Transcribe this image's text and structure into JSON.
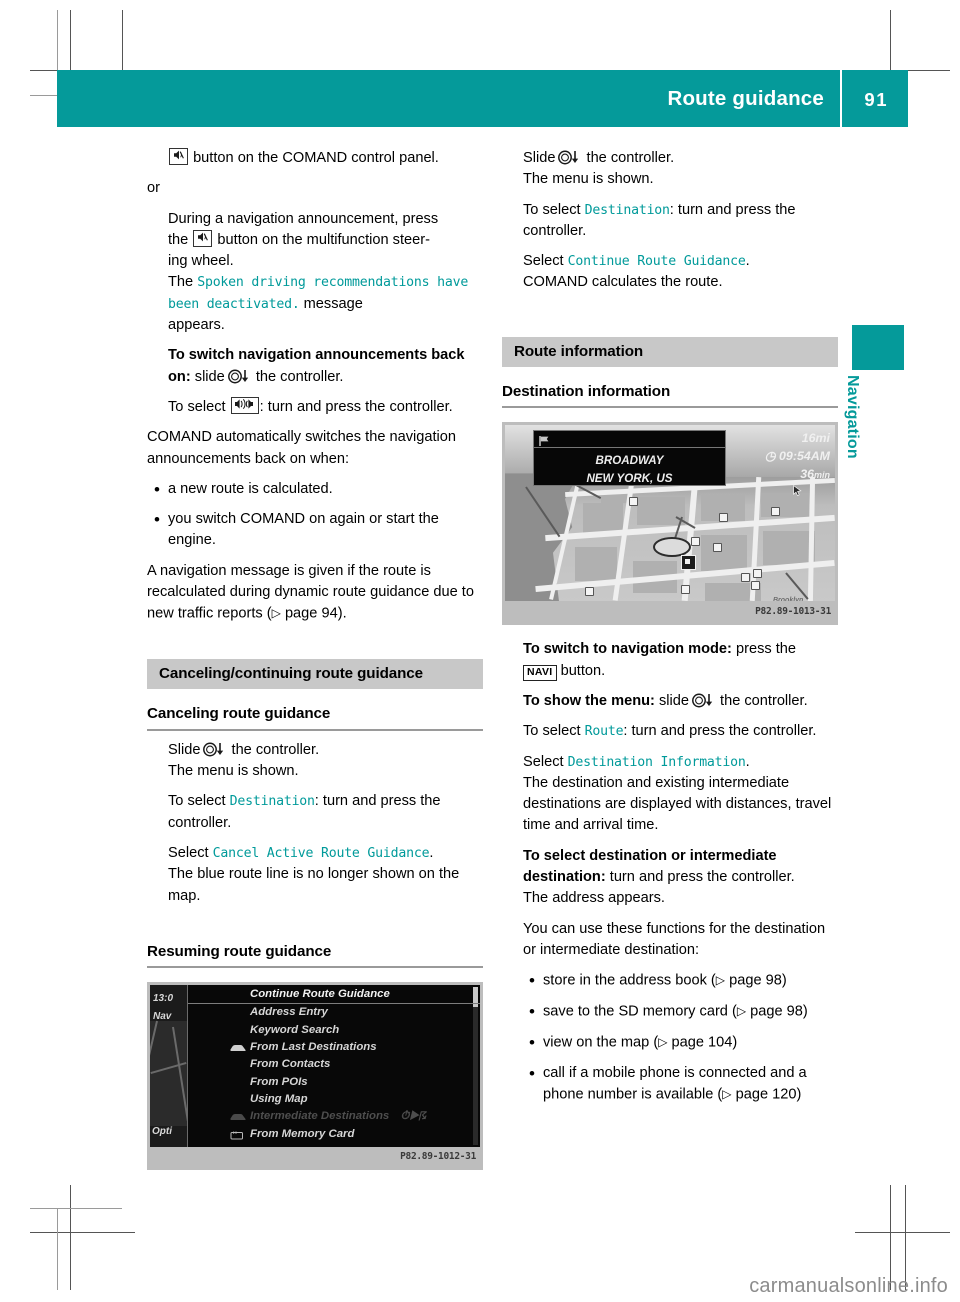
{
  "header": {
    "title": "Route guidance",
    "page_number": "91"
  },
  "side_tab": {
    "label": "Navigation"
  },
  "watermark": "carmanualsonline.info",
  "left_column": {
    "step_mute_button": {
      "text_after_icon": "button on the COMAND control panel.",
      "icon": "speaker-mute-icon"
    },
    "or_label": "or",
    "step_announcement": {
      "lead": "During a navigation announcement, press",
      "line2_pre": "the",
      "line2_post": "button on the multifunction steer-",
      "line3": "ing wheel.",
      "line4_pre": "The",
      "message": "Spoken driving recommendations have been deactivated.",
      "line4_post": "message",
      "line5": "appears."
    },
    "step_switch_back": {
      "bold": "To switch navigation announcements back on:",
      "rest_pre": "slide",
      "rest_post": "the controller."
    },
    "step_select_speaker": {
      "pre": "To select",
      "post": ": turn and press the controller."
    },
    "para_auto": "COMAND automatically switches the navigation announcements back on when:",
    "bullets_auto": [
      "a new route is calculated.",
      "you switch COMAND on again or start the engine."
    ],
    "para_message": {
      "text_pre": "A navigation message is given if the route is recalculated during dynamic route guidance due to new traffic reports (",
      "page_ref": "page 94",
      "text_post": ")."
    },
    "section_heading": "Canceling/continuing route guidance",
    "sub_heading_cancel": "Canceling route guidance",
    "cancel_steps": {
      "slide_pre": "Slide",
      "slide_post": "the controller.",
      "menu_shown": "The menu is shown.",
      "select_pre": "To select",
      "select_mono": "Destination",
      "select_post": ": turn and press the controller.",
      "select2_pre": "Select",
      "select2_mono": "Cancel Active Route Guidance",
      "select2_post": ".",
      "result": "The blue route line is no longer shown on the map."
    },
    "sub_heading_resume": "Resuming route guidance",
    "figure_menu": {
      "caption": "P82.89-1012-31",
      "left_labels": {
        "time": "13:0",
        "nav": "Nav",
        "options": "Opti"
      },
      "items": [
        {
          "label": "Continue Route Guidance",
          "icon": "",
          "dim": false,
          "selected": true
        },
        {
          "label": "Address Entry",
          "icon": "",
          "dim": false,
          "selected": false
        },
        {
          "label": "Keyword Search",
          "icon": "",
          "dim": false,
          "selected": false
        },
        {
          "label": "From Last Destinations",
          "icon": "car-icon",
          "dim": false,
          "selected": false
        },
        {
          "label": "From Contacts",
          "icon": "",
          "dim": false,
          "selected": false
        },
        {
          "label": "From POIs",
          "icon": "",
          "dim": false,
          "selected": false
        },
        {
          "label": "Using Map",
          "icon": "",
          "dim": false,
          "selected": false
        },
        {
          "label": "Intermediate Destinations",
          "icon": "car-icon",
          "dim": true,
          "selected": false
        },
        {
          "label": "From Memory Card",
          "icon": "sd-card-icon",
          "dim": false,
          "selected": false
        }
      ]
    }
  },
  "right_column": {
    "resume_steps": {
      "slide_pre": "Slide",
      "slide_post": "the controller.",
      "menu_shown": "The menu is shown.",
      "select_pre": "To select",
      "select_mono": "Destination",
      "select_post": ": turn and press the controller.",
      "select2_pre": "Select",
      "select2_mono": "Continue Route Guidance",
      "select2_post": ".",
      "result": "COMAND calculates the route."
    },
    "section_heading": "Route information",
    "sub_heading": "Destination information",
    "figure_map": {
      "caption": "P82.89-1013-31",
      "street": "BROADWAY",
      "city": "NEW YORK, US",
      "distance": "16mi",
      "arrival_time": "09:54AM",
      "travel_time": "36",
      "travel_time_unit": "min",
      "map_labels": [
        "Brooklyn"
      ]
    },
    "steps": {
      "nav_mode_bold": "To switch to navigation mode:",
      "nav_mode_pre": "press the",
      "nav_mode_btn": "NAVI",
      "nav_mode_post": "button.",
      "show_menu_bold": "To show the menu:",
      "show_menu_pre": "slide",
      "show_menu_post": "the controller.",
      "select_route_pre": "To select",
      "select_route_mono": "Route",
      "select_route_post": ": turn and press the controller.",
      "select_dest_pre": "Select",
      "select_dest_mono": "Destination Information",
      "select_dest_post": ".",
      "dest_result": "The destination and existing intermediate destinations are displayed with distances, travel time and arrival time.",
      "select_dest_bold": "To select destination or intermediate destination:",
      "select_dest_rest": "turn and press the controller.",
      "address_appears": "The address appears.",
      "functions_intro": "You can use these functions for the destination or intermediate destination:"
    },
    "function_bullets": [
      {
        "text_pre": "store in the address book (",
        "page_ref": "page 98",
        "text_post": ")"
      },
      {
        "text_pre": "save to the SD memory card (",
        "page_ref": "page 98",
        "text_post": ")"
      },
      {
        "text_pre": "view on the map (",
        "page_ref": "page 104",
        "text_post": ")"
      },
      {
        "text_pre": "call if a mobile phone is connected and a phone number is available (",
        "page_ref": "page 120",
        "text_post": ")"
      }
    ]
  },
  "colors": {
    "teal": "#059a9a",
    "mono_teal": "#009a9a",
    "section_grey": "#c8c8c8"
  }
}
